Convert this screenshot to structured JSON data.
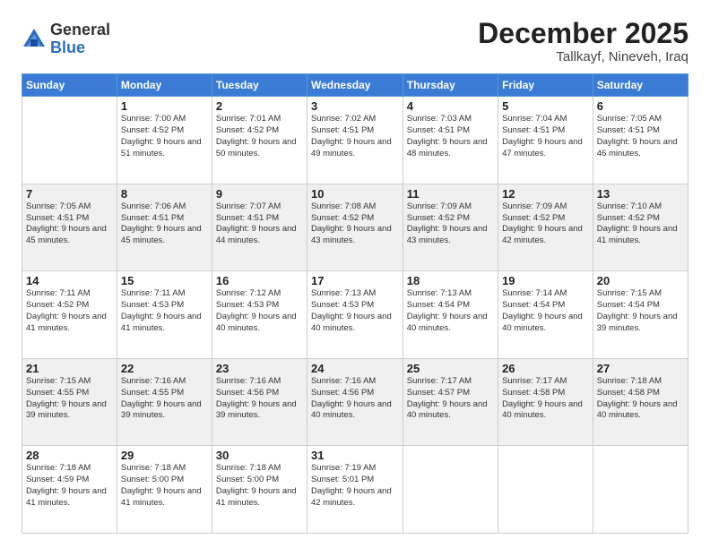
{
  "header": {
    "logo_general": "General",
    "logo_blue": "Blue",
    "month": "December 2025",
    "location": "Tallkayf, Nineveh, Iraq"
  },
  "days_of_week": [
    "Sunday",
    "Monday",
    "Tuesday",
    "Wednesday",
    "Thursday",
    "Friday",
    "Saturday"
  ],
  "weeks": [
    [
      {
        "day": "",
        "sunrise": "",
        "sunset": "",
        "daylight": ""
      },
      {
        "day": "1",
        "sunrise": "Sunrise: 7:00 AM",
        "sunset": "Sunset: 4:52 PM",
        "daylight": "Daylight: 9 hours and 51 minutes."
      },
      {
        "day": "2",
        "sunrise": "Sunrise: 7:01 AM",
        "sunset": "Sunset: 4:52 PM",
        "daylight": "Daylight: 9 hours and 50 minutes."
      },
      {
        "day": "3",
        "sunrise": "Sunrise: 7:02 AM",
        "sunset": "Sunset: 4:51 PM",
        "daylight": "Daylight: 9 hours and 49 minutes."
      },
      {
        "day": "4",
        "sunrise": "Sunrise: 7:03 AM",
        "sunset": "Sunset: 4:51 PM",
        "daylight": "Daylight: 9 hours and 48 minutes."
      },
      {
        "day": "5",
        "sunrise": "Sunrise: 7:04 AM",
        "sunset": "Sunset: 4:51 PM",
        "daylight": "Daylight: 9 hours and 47 minutes."
      },
      {
        "day": "6",
        "sunrise": "Sunrise: 7:05 AM",
        "sunset": "Sunset: 4:51 PM",
        "daylight": "Daylight: 9 hours and 46 minutes."
      }
    ],
    [
      {
        "day": "7",
        "sunrise": "Sunrise: 7:05 AM",
        "sunset": "Sunset: 4:51 PM",
        "daylight": "Daylight: 9 hours and 45 minutes."
      },
      {
        "day": "8",
        "sunrise": "Sunrise: 7:06 AM",
        "sunset": "Sunset: 4:51 PM",
        "daylight": "Daylight: 9 hours and 45 minutes."
      },
      {
        "day": "9",
        "sunrise": "Sunrise: 7:07 AM",
        "sunset": "Sunset: 4:51 PM",
        "daylight": "Daylight: 9 hours and 44 minutes."
      },
      {
        "day": "10",
        "sunrise": "Sunrise: 7:08 AM",
        "sunset": "Sunset: 4:52 PM",
        "daylight": "Daylight: 9 hours and 43 minutes."
      },
      {
        "day": "11",
        "sunrise": "Sunrise: 7:09 AM",
        "sunset": "Sunset: 4:52 PM",
        "daylight": "Daylight: 9 hours and 43 minutes."
      },
      {
        "day": "12",
        "sunrise": "Sunrise: 7:09 AM",
        "sunset": "Sunset: 4:52 PM",
        "daylight": "Daylight: 9 hours and 42 minutes."
      },
      {
        "day": "13",
        "sunrise": "Sunrise: 7:10 AM",
        "sunset": "Sunset: 4:52 PM",
        "daylight": "Daylight: 9 hours and 41 minutes."
      }
    ],
    [
      {
        "day": "14",
        "sunrise": "Sunrise: 7:11 AM",
        "sunset": "Sunset: 4:52 PM",
        "daylight": "Daylight: 9 hours and 41 minutes."
      },
      {
        "day": "15",
        "sunrise": "Sunrise: 7:11 AM",
        "sunset": "Sunset: 4:53 PM",
        "daylight": "Daylight: 9 hours and 41 minutes."
      },
      {
        "day": "16",
        "sunrise": "Sunrise: 7:12 AM",
        "sunset": "Sunset: 4:53 PM",
        "daylight": "Daylight: 9 hours and 40 minutes."
      },
      {
        "day": "17",
        "sunrise": "Sunrise: 7:13 AM",
        "sunset": "Sunset: 4:53 PM",
        "daylight": "Daylight: 9 hours and 40 minutes."
      },
      {
        "day": "18",
        "sunrise": "Sunrise: 7:13 AM",
        "sunset": "Sunset: 4:54 PM",
        "daylight": "Daylight: 9 hours and 40 minutes."
      },
      {
        "day": "19",
        "sunrise": "Sunrise: 7:14 AM",
        "sunset": "Sunset: 4:54 PM",
        "daylight": "Daylight: 9 hours and 40 minutes."
      },
      {
        "day": "20",
        "sunrise": "Sunrise: 7:15 AM",
        "sunset": "Sunset: 4:54 PM",
        "daylight": "Daylight: 9 hours and 39 minutes."
      }
    ],
    [
      {
        "day": "21",
        "sunrise": "Sunrise: 7:15 AM",
        "sunset": "Sunset: 4:55 PM",
        "daylight": "Daylight: 9 hours and 39 minutes."
      },
      {
        "day": "22",
        "sunrise": "Sunrise: 7:16 AM",
        "sunset": "Sunset: 4:55 PM",
        "daylight": "Daylight: 9 hours and 39 minutes."
      },
      {
        "day": "23",
        "sunrise": "Sunrise: 7:16 AM",
        "sunset": "Sunset: 4:56 PM",
        "daylight": "Daylight: 9 hours and 39 minutes."
      },
      {
        "day": "24",
        "sunrise": "Sunrise: 7:16 AM",
        "sunset": "Sunset: 4:56 PM",
        "daylight": "Daylight: 9 hours and 40 minutes."
      },
      {
        "day": "25",
        "sunrise": "Sunrise: 7:17 AM",
        "sunset": "Sunset: 4:57 PM",
        "daylight": "Daylight: 9 hours and 40 minutes."
      },
      {
        "day": "26",
        "sunrise": "Sunrise: 7:17 AM",
        "sunset": "Sunset: 4:58 PM",
        "daylight": "Daylight: 9 hours and 40 minutes."
      },
      {
        "day": "27",
        "sunrise": "Sunrise: 7:18 AM",
        "sunset": "Sunset: 4:58 PM",
        "daylight": "Daylight: 9 hours and 40 minutes."
      }
    ],
    [
      {
        "day": "28",
        "sunrise": "Sunrise: 7:18 AM",
        "sunset": "Sunset: 4:59 PM",
        "daylight": "Daylight: 9 hours and 41 minutes."
      },
      {
        "day": "29",
        "sunrise": "Sunrise: 7:18 AM",
        "sunset": "Sunset: 5:00 PM",
        "daylight": "Daylight: 9 hours and 41 minutes."
      },
      {
        "day": "30",
        "sunrise": "Sunrise: 7:18 AM",
        "sunset": "Sunset: 5:00 PM",
        "daylight": "Daylight: 9 hours and 41 minutes."
      },
      {
        "day": "31",
        "sunrise": "Sunrise: 7:19 AM",
        "sunset": "Sunset: 5:01 PM",
        "daylight": "Daylight: 9 hours and 42 minutes."
      },
      {
        "day": "",
        "sunrise": "",
        "sunset": "",
        "daylight": ""
      },
      {
        "day": "",
        "sunrise": "",
        "sunset": "",
        "daylight": ""
      },
      {
        "day": "",
        "sunrise": "",
        "sunset": "",
        "daylight": ""
      }
    ]
  ]
}
